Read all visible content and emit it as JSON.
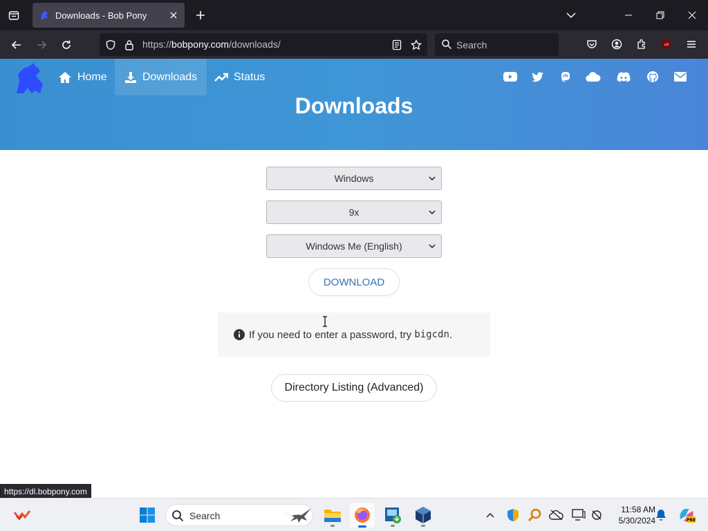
{
  "browser": {
    "tab_title": "Downloads - Bob Pony",
    "url_scheme": "https://",
    "url_host": "bobpony.com",
    "url_path": "/downloads/",
    "search_placeholder": "Search"
  },
  "site": {
    "nav": [
      {
        "label": "Home"
      },
      {
        "label": "Downloads"
      },
      {
        "label": "Status"
      }
    ],
    "page_title": "Downloads",
    "social_icons": [
      "youtube-icon",
      "twitter-icon",
      "mastodon-icon",
      "cloud-icon",
      "discord-icon",
      "github-icon",
      "mail-icon"
    ]
  },
  "form": {
    "os_select": "Windows",
    "family_select": "9x",
    "version_select": "Windows Me (English)",
    "download_label": "DOWNLOAD",
    "notice_text": "If you need to enter a password, try",
    "notice_code": "bigcdn",
    "notice_end": ".",
    "directory_label": "Directory Listing (Advanced)"
  },
  "status_bar": {
    "link": "https://dl.bobpony.com"
  },
  "taskbar": {
    "search_placeholder": "Search",
    "time": "11:58 AM",
    "date": "5/30/2024"
  },
  "colors": {
    "header_blue": "#3f96d6",
    "download_text": "#3b6fb6",
    "chrome_dark": "#1c1b22"
  }
}
